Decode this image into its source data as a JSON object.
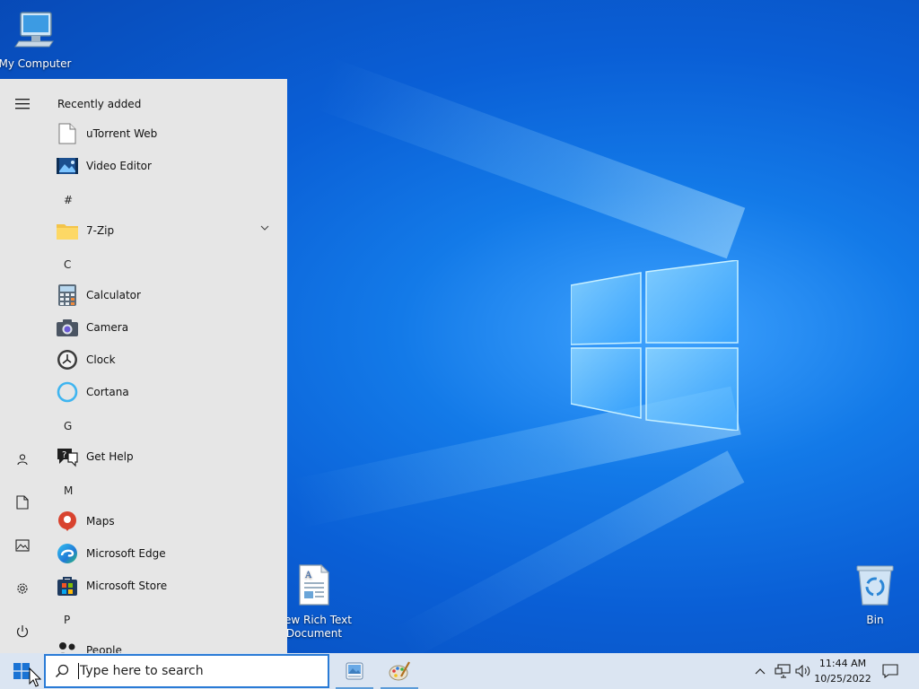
{
  "desktop": {
    "icons": {
      "my_computer": "My Computer",
      "rich_text": "New Rich Text Document",
      "bin": "Bin"
    }
  },
  "start_menu": {
    "section_title": "Recently added",
    "recent": [
      {
        "label": "uTorrent Web",
        "icon": "document-icon"
      },
      {
        "label": "Video Editor",
        "icon": "video-editor-icon"
      }
    ],
    "groups": [
      {
        "letter": "#",
        "apps": [
          {
            "label": "7-Zip",
            "icon": "folder-icon",
            "expandable": true
          }
        ]
      },
      {
        "letter": "C",
        "apps": [
          {
            "label": "Calculator",
            "icon": "calculator-icon"
          },
          {
            "label": "Camera",
            "icon": "camera-icon"
          },
          {
            "label": "Clock",
            "icon": "clock-icon"
          },
          {
            "label": "Cortana",
            "icon": "cortana-icon"
          }
        ]
      },
      {
        "letter": "G",
        "apps": [
          {
            "label": "Get Help",
            "icon": "help-icon"
          }
        ]
      },
      {
        "letter": "M",
        "apps": [
          {
            "label": "Maps",
            "icon": "maps-icon"
          },
          {
            "label": "Microsoft Edge",
            "icon": "edge-icon"
          },
          {
            "label": "Microsoft Store",
            "icon": "store-icon"
          }
        ]
      },
      {
        "letter": "P",
        "apps": [
          {
            "label": "People",
            "icon": "people-icon"
          }
        ]
      }
    ],
    "rail": [
      "menu-icon",
      "user-icon",
      "documents-icon",
      "pictures-icon",
      "settings-icon",
      "power-icon"
    ]
  },
  "taskbar": {
    "search_placeholder": "Type here to search",
    "pinned": [
      "image-viewer-icon",
      "paint-icon"
    ],
    "time": "11:44 AM",
    "date": "10/25/2022"
  },
  "colors": {
    "accent": "#2a7bd6",
    "start_bg": "#e6e6e6",
    "taskbar_bg": "#dbe5f2"
  }
}
